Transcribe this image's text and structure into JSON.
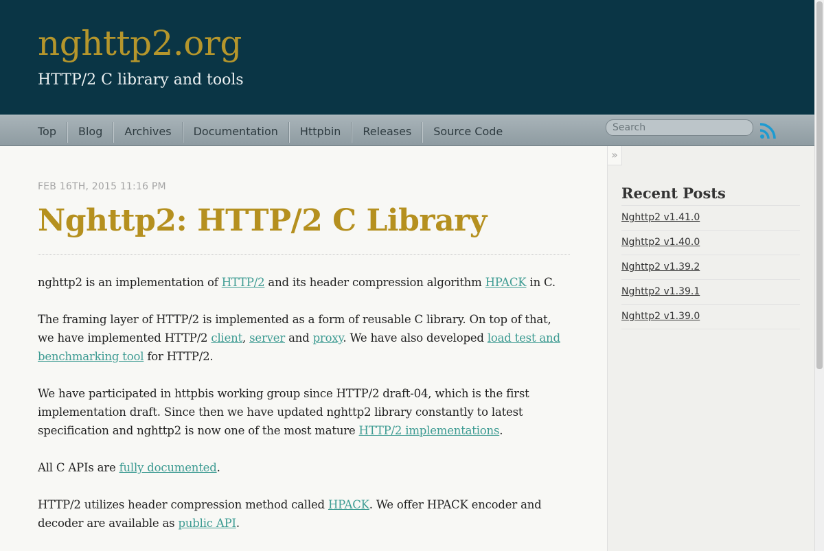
{
  "header": {
    "title": "nghttp2.org",
    "subtitle": "HTTP/2 C library and tools"
  },
  "nav": {
    "items": [
      "Top",
      "Blog",
      "Archives",
      "Documentation",
      "Httpbin",
      "Releases",
      "Source Code"
    ],
    "search_placeholder": "Search",
    "rss_icon": "rss-icon"
  },
  "post": {
    "date": "FEB 16TH, 2015 11:16 PM",
    "title": "Nghttp2: HTTP/2 C Library",
    "p1": {
      "t1": "nghttp2 is an implementation of ",
      "l1": "HTTP/2",
      "t2": " and its header compression algorithm ",
      "l2": "HPACK",
      "t3": " in C."
    },
    "p2": {
      "t1": "The framing layer of HTTP/2 is implemented as a form of reusable C library. On top of that, we have implemented HTTP/2 ",
      "l1": "client",
      "t2": ", ",
      "l2": "server",
      "t3": " and ",
      "l3": "proxy",
      "t4": ". We have also developed ",
      "l4": "load test and benchmarking tool",
      "t5": " for HTTP/2."
    },
    "p3": {
      "t1": "We have participated in httpbis working group since HTTP/2 draft-04, which is the first implementation draft. Since then we have updated nghttp2 library constantly to latest specification and nghttp2 is now one of the most mature ",
      "l1": "HTTP/2 implementations",
      "t2": "."
    },
    "p4": {
      "t1": "All C APIs are ",
      "l1": "fully documented",
      "t2": "."
    },
    "p5": {
      "t1": "HTTP/2 utilizes header compression method called ",
      "l1": "HPACK",
      "t2": ". We offer HPACK encoder and decoder are available as ",
      "l2": "public API",
      "t3": "."
    }
  },
  "sidebar": {
    "toggle_label": "»",
    "recent_title": "Recent Posts",
    "recent_posts": [
      "Nghttp2 v1.41.0",
      "Nghttp2 v1.40.0",
      "Nghttp2 v1.39.2",
      "Nghttp2 v1.39.1",
      "Nghttp2 v1.39.0"
    ]
  },
  "colors": {
    "header_bg": "#0a3545",
    "title_gold": "#b5962c",
    "link_teal": "#3d9b92",
    "rss_blue": "#1d9bd1"
  }
}
